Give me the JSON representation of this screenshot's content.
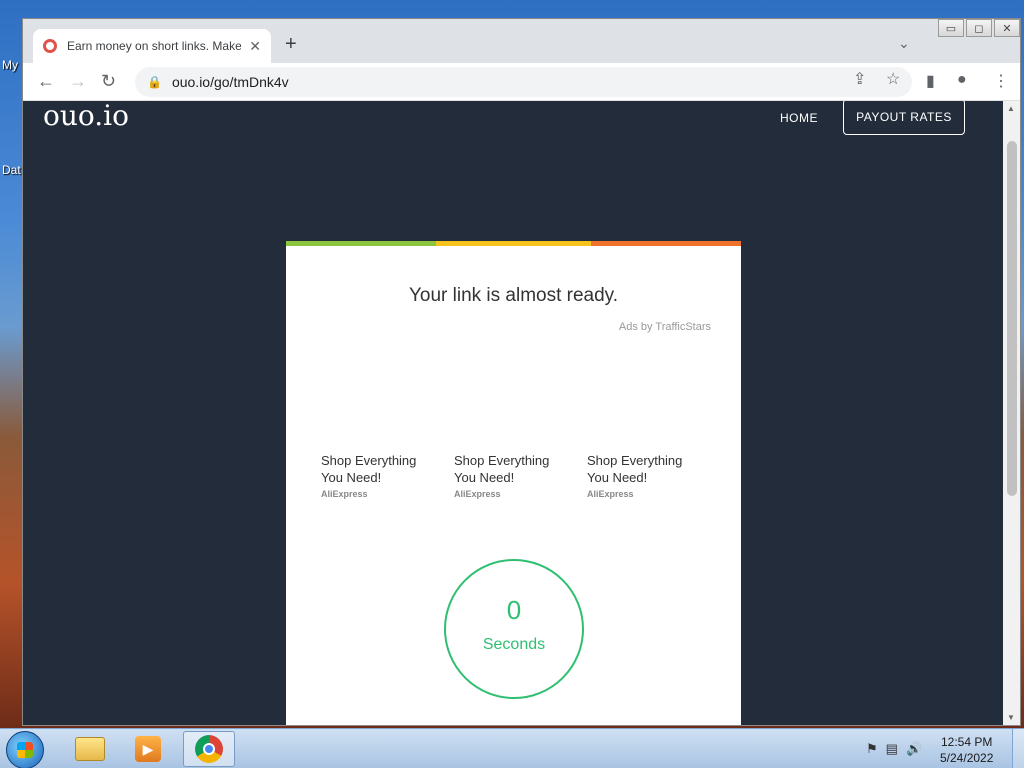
{
  "desktop": {
    "icon_labels": [
      "My",
      "Dat"
    ]
  },
  "browser": {
    "tab_title": "Earn money on short links. Make",
    "url": "ouo.io/go/tmDnk4v",
    "window_buttons": [
      "▭",
      "◻",
      "✕"
    ]
  },
  "site": {
    "logo": "ouo.io",
    "nav_home": "HOME",
    "nav_payout": "PAYOUT RATES"
  },
  "card": {
    "title": "Your link is almost ready.",
    "ads_by": "Ads by TrafficStars",
    "bar_colors": [
      "#8cc63f",
      "#f5c31c",
      "#f0712c"
    ],
    "ads": [
      {
        "title": "Shop Everything You Need!",
        "source": "AliExpress"
      },
      {
        "title": "Shop Everything You Need!",
        "source": "AliExpress"
      },
      {
        "title": "Shop Everything You Need!",
        "source": "AliExpress"
      }
    ],
    "timer_value": "0",
    "timer_label": "Seconds"
  },
  "taskbar": {
    "time": "12:54 PM",
    "date": "5/24/2022"
  },
  "colors": {
    "page_bg": "#232c3a",
    "timer_green": "#2fbf71"
  }
}
